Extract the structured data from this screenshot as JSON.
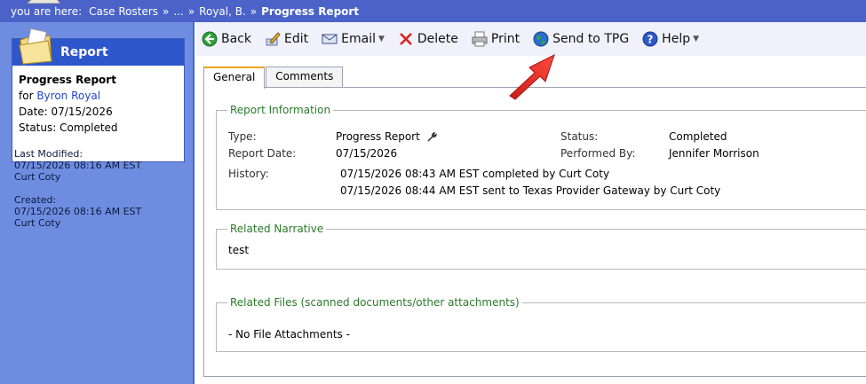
{
  "breadcrumb": {
    "prefix": "you are here:",
    "items": [
      "Case Rosters",
      "...",
      "Royal, B."
    ],
    "current": "Progress Report",
    "separator": "»"
  },
  "sidebar": {
    "card_title": "Report",
    "report_name": "Progress Report",
    "for_label": "for",
    "client_name": "Byron Royal",
    "date_line": "Date: 07/15/2026",
    "status_line": "Status: Completed",
    "last_modified_label": "Last Modified:",
    "last_modified_date": "07/15/2026 08:16 AM EST",
    "last_modified_by": "Curt Coty",
    "created_label": "Created:",
    "created_date": "07/15/2026 08:16 AM EST",
    "created_by": "Curt Coty"
  },
  "toolbar": {
    "back": "Back",
    "edit": "Edit",
    "email": "Email",
    "delete": "Delete",
    "print": "Print",
    "send": "Send to TPG",
    "help": "Help"
  },
  "tabs": [
    "General",
    "Comments"
  ],
  "report_info": {
    "legend": "Report Information",
    "type_label": "Type:",
    "type_value": "Progress Report",
    "date_label": "Report Date:",
    "date_value": "07/15/2026",
    "status_label": "Status:",
    "status_value": "Completed",
    "performed_label": "Performed By:",
    "performed_value": "Jennifer Morrison",
    "history_label": "History:",
    "history": [
      "07/15/2026 08:43 AM EST completed by Curt Coty",
      "07/15/2026 08:44 AM EST sent to Texas Provider Gateway by Curt Coty"
    ]
  },
  "narrative": {
    "legend": "Related Narrative",
    "text": "test"
  },
  "files": {
    "legend": "Related Files (scanned documents/other attachments)",
    "empty_text": "- No File Attachments -"
  },
  "colors": {
    "breadcrumb_bg": "#4b63c8",
    "sidebar_bg": "#6f8de0",
    "card_header": "#2f57cc",
    "legend_green": "#2b7a2b",
    "tab_accent": "#f0a224",
    "arrow_red": "#e8302a"
  },
  "icons": {
    "back": "green-back-arrow-icon",
    "edit": "pencil-edit-icon",
    "email": "envelope-icon",
    "delete": "red-x-icon",
    "print": "printer-icon",
    "send": "globe-icon",
    "help": "question-circle-icon"
  }
}
